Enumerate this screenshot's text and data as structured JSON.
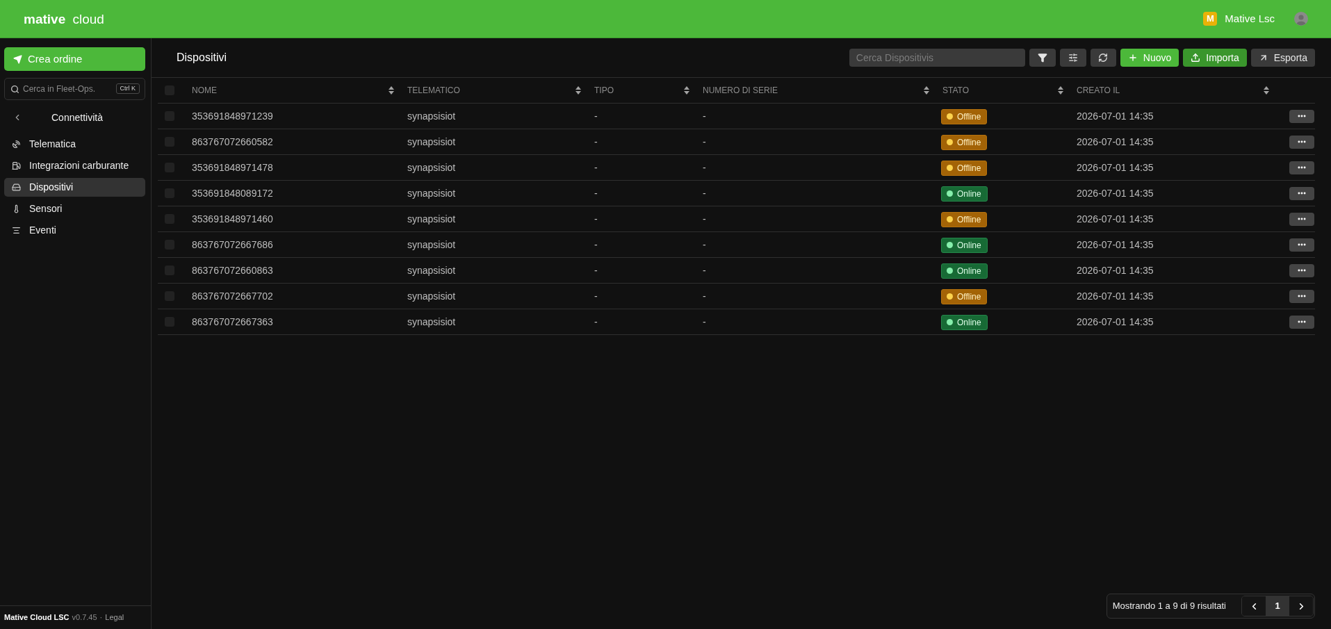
{
  "topbar": {
    "logo": "**mative** cloud",
    "org_badge": "M",
    "org_name": "Mative Lsc"
  },
  "sidebar": {
    "create_button": "Crea ordine",
    "search": {
      "placeholder": "Cerca in Fleet-Ops.",
      "shortcut": "Ctrl K"
    },
    "section_title": "Connettività",
    "items": [
      {
        "label": "Telematica",
        "selected": false
      },
      {
        "label": "Integrazioni carburante",
        "selected": false
      },
      {
        "label": "Dispositivi",
        "selected": true
      },
      {
        "label": "Sensori",
        "selected": false
      },
      {
        "label": "Eventi",
        "selected": false
      }
    ],
    "footer": {
      "brand": "Mative Cloud LSC",
      "version": "v0.7.45",
      "separator": "·",
      "link": "Legal"
    }
  },
  "header": {
    "title": "Dispositivi",
    "search": {
      "placeholder": "Cerca Dispositivis"
    },
    "buttons": [
      {
        "label": "Nuovo",
        "kind": "primary"
      },
      {
        "label": "Importa",
        "kind": "secondary"
      },
      {
        "label": "Esporta",
        "kind": "neutral"
      }
    ]
  },
  "table": {
    "select_all": {
      "checked": false
    },
    "columns": [
      "NOME",
      "TELEMATICO",
      "TIPO",
      "NUMERO DI SERIE",
      "STATO",
      "CREATO IL"
    ],
    "rows": [
      {
        "checked": false,
        "nome": "353691848971239",
        "telematico": "synapsisiot",
        "tipo": "-",
        "numero_di_serie": "-",
        "stato": {
          "label": "Offline",
          "kind": "offline"
        },
        "creato_il": "2026-07-01 14:35"
      },
      {
        "checked": false,
        "nome": "863767072660582",
        "telematico": "synapsisiot",
        "tipo": "-",
        "numero_di_serie": "-",
        "stato": {
          "label": "Offline",
          "kind": "offline"
        },
        "creato_il": "2026-07-01 14:35"
      },
      {
        "checked": false,
        "nome": "353691848971478",
        "telematico": "synapsisiot",
        "tipo": "-",
        "numero_di_serie": "-",
        "stato": {
          "label": "Offline",
          "kind": "offline"
        },
        "creato_il": "2026-07-01 14:35"
      },
      {
        "checked": false,
        "nome": "353691848089172",
        "telematico": "synapsisiot",
        "tipo": "-",
        "numero_di_serie": "-",
        "stato": {
          "label": "Online",
          "kind": "online"
        },
        "creato_il": "2026-07-01 14:35"
      },
      {
        "checked": false,
        "nome": "353691848971460",
        "telematico": "synapsisiot",
        "tipo": "-",
        "numero_di_serie": "-",
        "stato": {
          "label": "Offline",
          "kind": "offline"
        },
        "creato_il": "2026-07-01 14:35"
      },
      {
        "checked": false,
        "nome": "863767072667686",
        "telematico": "synapsisiot",
        "tipo": "-",
        "numero_di_serie": "-",
        "stato": {
          "label": "Online",
          "kind": "online"
        },
        "creato_il": "2026-07-01 14:35"
      },
      {
        "checked": false,
        "nome": "863767072660863",
        "telematico": "synapsisiot",
        "tipo": "-",
        "numero_di_serie": "-",
        "stato": {
          "label": "Online",
          "kind": "online"
        },
        "creato_il": "2026-07-01 14:35"
      },
      {
        "checked": false,
        "nome": "863767072667702",
        "telematico": "synapsisiot",
        "tipo": "-",
        "numero_di_serie": "-",
        "stato": {
          "label": "Offline",
          "kind": "offline"
        },
        "creato_il": "2026-07-01 14:35"
      },
      {
        "checked": false,
        "nome": "863767072667363",
        "telematico": "synapsisiot",
        "tipo": "-",
        "numero_di_serie": "-",
        "stato": {
          "label": "Online",
          "kind": "online"
        },
        "creato_il": "2026-07-01 14:35"
      }
    ]
  },
  "pagination": {
    "summary": "Mostrando 1 a 9 di 9 risultati",
    "pages": [
      {
        "label": "1",
        "selected": true
      }
    ]
  }
}
